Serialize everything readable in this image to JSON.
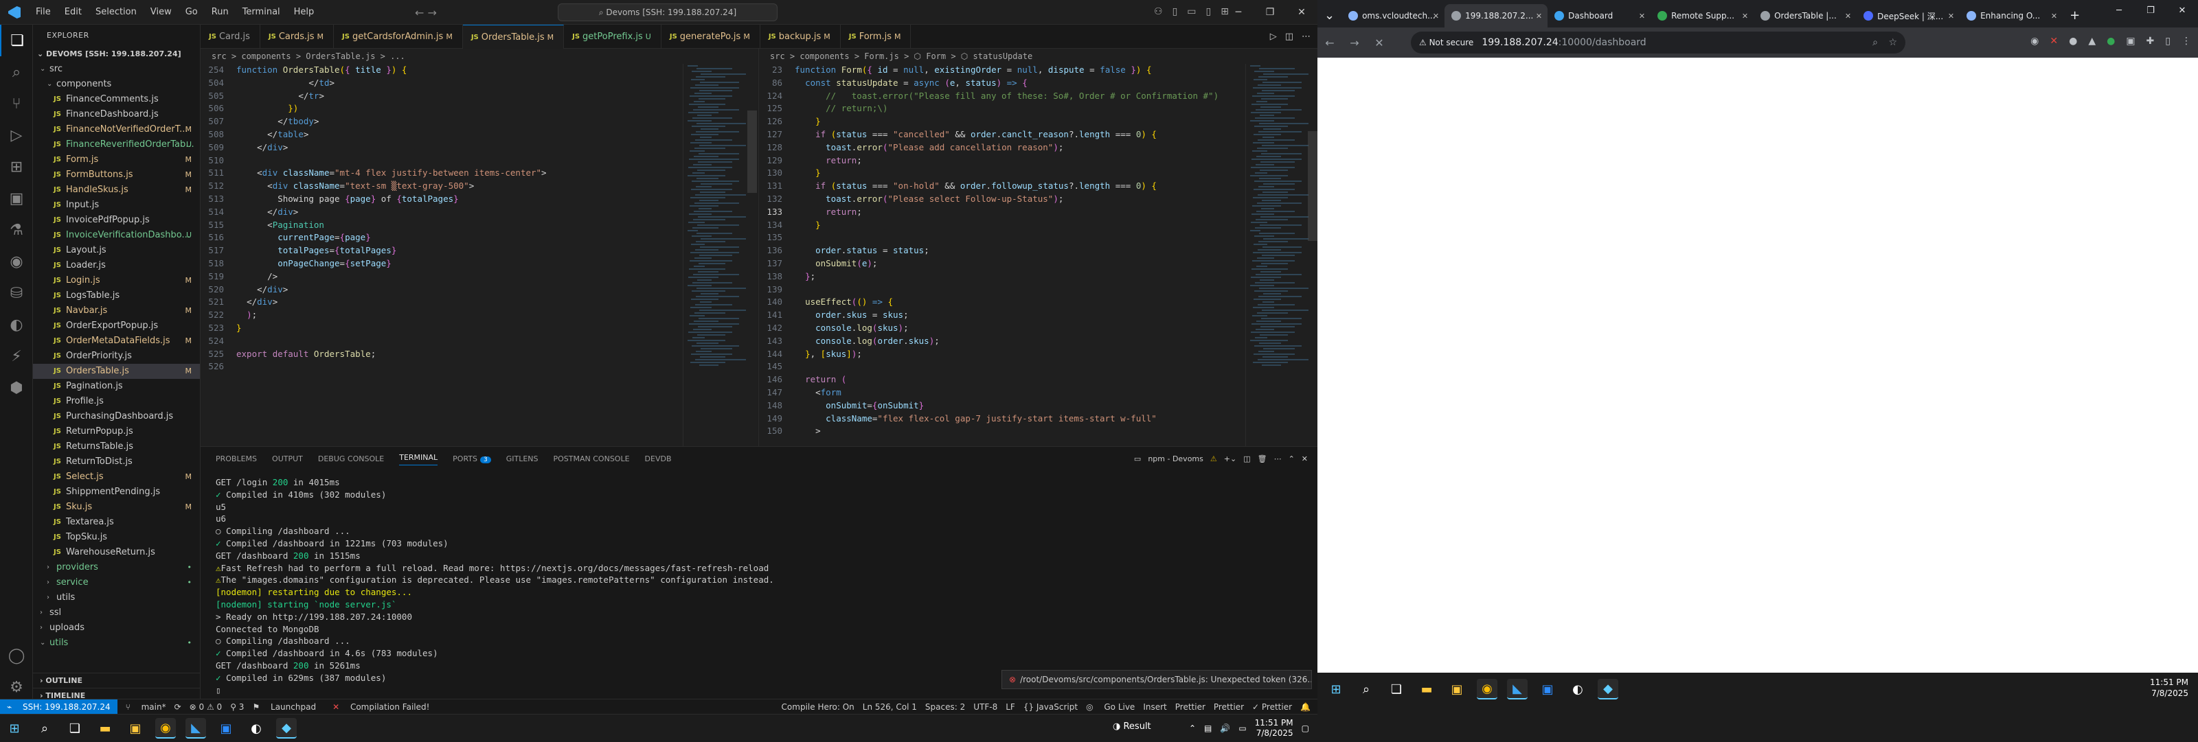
{
  "vscode": {
    "menu": [
      "File",
      "Edit",
      "Selection",
      "View",
      "Go",
      "Run",
      "Terminal",
      "Help"
    ],
    "command_center": "Devoms [SSH: 199.188.207.24]",
    "explorer_title": "EXPLORER",
    "workspace_root": "DEVOMS [SSH: 199.188.207.24]",
    "tree": [
      {
        "label": "src",
        "kind": "folder",
        "level": 1,
        "badge": ""
      },
      {
        "label": "components",
        "kind": "folder",
        "level": 2,
        "badge": ""
      },
      {
        "label": "FinanceComments.js",
        "kind": "file",
        "level": 3,
        "badge": ""
      },
      {
        "label": "FinanceDashboard.js",
        "kind": "file",
        "level": 3,
        "badge": ""
      },
      {
        "label": "FinanceNotVerifiedOrderT...",
        "kind": "file",
        "level": 3,
        "badge": "M"
      },
      {
        "label": "FinanceReverifiedOrderTab...",
        "kind": "file",
        "level": 3,
        "badge": "U"
      },
      {
        "label": "Form.js",
        "kind": "file",
        "level": 3,
        "badge": "M"
      },
      {
        "label": "FormButtons.js",
        "kind": "file",
        "level": 3,
        "badge": "M"
      },
      {
        "label": "HandleSkus.js",
        "kind": "file",
        "level": 3,
        "badge": "M"
      },
      {
        "label": "Input.js",
        "kind": "file",
        "level": 3,
        "badge": ""
      },
      {
        "label": "InvoicePdfPopup.js",
        "kind": "file",
        "level": 3,
        "badge": ""
      },
      {
        "label": "InvoiceVerificationDashbo...",
        "kind": "file",
        "level": 3,
        "badge": "U"
      },
      {
        "label": "Layout.js",
        "kind": "file",
        "level": 3,
        "badge": ""
      },
      {
        "label": "Loader.js",
        "kind": "file",
        "level": 3,
        "badge": ""
      },
      {
        "label": "Login.js",
        "kind": "file",
        "level": 3,
        "badge": "M"
      },
      {
        "label": "LogsTable.js",
        "kind": "file",
        "level": 3,
        "badge": ""
      },
      {
        "label": "Navbar.js",
        "kind": "file",
        "level": 3,
        "badge": "M"
      },
      {
        "label": "OrderExportPopup.js",
        "kind": "file",
        "level": 3,
        "badge": ""
      },
      {
        "label": "OrderMetaDataFields.js",
        "kind": "file",
        "level": 3,
        "badge": "M"
      },
      {
        "label": "OrderPriority.js",
        "kind": "file",
        "level": 3,
        "badge": ""
      },
      {
        "label": "OrdersTable.js",
        "kind": "file",
        "level": 3,
        "badge": "M",
        "selected": true
      },
      {
        "label": "Pagination.js",
        "kind": "file",
        "level": 3,
        "badge": ""
      },
      {
        "label": "Profile.js",
        "kind": "file",
        "level": 3,
        "badge": ""
      },
      {
        "label": "PurchasingDashboard.js",
        "kind": "file",
        "level": 3,
        "badge": ""
      },
      {
        "label": "ReturnPopup.js",
        "kind": "file",
        "level": 3,
        "badge": ""
      },
      {
        "label": "ReturnsTable.js",
        "kind": "file",
        "level": 3,
        "badge": ""
      },
      {
        "label": "ReturnToDist.js",
        "kind": "file",
        "level": 3,
        "badge": ""
      },
      {
        "label": "Select.js",
        "kind": "file",
        "level": 3,
        "badge": "M"
      },
      {
        "label": "ShippmentPending.js",
        "kind": "file",
        "level": 3,
        "badge": ""
      },
      {
        "label": "Sku.js",
        "kind": "file",
        "level": 3,
        "badge": "M"
      },
      {
        "label": "Textarea.js",
        "kind": "file",
        "level": 3,
        "badge": ""
      },
      {
        "label": "TopSku.js",
        "kind": "file",
        "level": 3,
        "badge": ""
      },
      {
        "label": "WarehouseReturn.js",
        "kind": "file",
        "level": 3,
        "badge": ""
      },
      {
        "label": "providers",
        "kind": "folder",
        "level": 2,
        "badge": "•"
      },
      {
        "label": "service",
        "kind": "folder",
        "level": 2,
        "badge": "•"
      },
      {
        "label": "utils",
        "kind": "folder",
        "level": 2,
        "badge": ""
      },
      {
        "label": "ssl",
        "kind": "folder",
        "level": 1,
        "badge": ""
      },
      {
        "label": "uploads",
        "kind": "folder",
        "level": 1,
        "badge": ""
      },
      {
        "label": "utils",
        "kind": "folder",
        "level": 1,
        "badge": "•"
      }
    ],
    "outline_label": "OUTLINE",
    "timeline_label": "TIMELINE",
    "tabs": [
      {
        "label": "Card.js",
        "mod": ""
      },
      {
        "label": "Cards.js",
        "mod": "M"
      },
      {
        "label": "getCardsforAdmin.js",
        "mod": "M"
      },
      {
        "label": "OrdersTable.js",
        "mod": "M",
        "active": true
      },
      {
        "label": "getPoPrefix.js",
        "mod": "U"
      },
      {
        "label": "generatePo.js",
        "mod": "M"
      },
      {
        "label": "backup.js",
        "mod": "M"
      },
      {
        "label": "Form.js",
        "mod": "M"
      }
    ],
    "left_breadcrumb": "src > components > OrdersTable.js > ...",
    "right_breadcrumb": "src > components > Form.js > ⬡ Form > ⬡ statusUpdate",
    "left_code": [
      {
        "n": "254",
        "html": "<span class='kw'>function</span> <span class='fn'>OrdersTable</span><span class='br'>(</span><span class='pk'>{</span> <span class='vr'>title</span> <span class='pk'>}</span><span class='br'>)</span> <span class='br'>{</span>"
      },
      {
        "n": "504",
        "html": "              <span class='tx'>&lt;/</span><span class='tg'>td</span><span class='tx'>&gt;</span>"
      },
      {
        "n": "505",
        "html": "            <span class='tx'>&lt;/</span><span class='tg'>tr</span><span class='tx'>&gt;</span>"
      },
      {
        "n": "506",
        "html": "          <span class='br'>})</span>"
      },
      {
        "n": "507",
        "html": "        <span class='tx'>&lt;/</span><span class='tg'>tbody</span><span class='tx'>&gt;</span>"
      },
      {
        "n": "508",
        "html": "      <span class='tx'>&lt;/</span><span class='tg'>table</span><span class='tx'>&gt;</span>"
      },
      {
        "n": "509",
        "html": "    <span class='tx'>&lt;/</span><span class='tg'>div</span><span class='tx'>&gt;</span>"
      },
      {
        "n": "510",
        "html": ""
      },
      {
        "n": "511",
        "html": "    <span class='tx'>&lt;</span><span class='tg'>div</span> <span class='at'>className</span><span class='tx'>=</span><span class='str'>\"mt-4 flex justify-between items-center\"</span><span class='tx'>&gt;</span>"
      },
      {
        "n": "512",
        "html": "      <span class='tx'>&lt;</span><span class='tg'>div</span> <span class='at'>className</span><span class='tx'>=</span><span class='str'>\"text-sm ▒text-gray-500\"</span><span class='tx'>&gt;</span>"
      },
      {
        "n": "513",
        "html": "        <span class='tx'>Showing page </span><span class='pk'>{</span><span class='vr'>page</span><span class='pk'>}</span><span class='tx'> of </span><span class='pk'>{</span><span class='vr'>totalPages</span><span class='pk'>}</span>"
      },
      {
        "n": "514",
        "html": "      <span class='tx'>&lt;/</span><span class='tg'>div</span><span class='tx'>&gt;</span>"
      },
      {
        "n": "515",
        "html": "      <span class='tx'>&lt;</span><span class='cp'>Pagination</span>"
      },
      {
        "n": "516",
        "html": "        <span class='at'>currentPage</span><span class='tx'>=</span><span class='pk'>{</span><span class='vr'>page</span><span class='pk'>}</span>"
      },
      {
        "n": "517",
        "html": "        <span class='at'>totalPages</span><span class='tx'>=</span><span class='pk'>{</span><span class='vr'>totalPages</span><span class='pk'>}</span>"
      },
      {
        "n": "518",
        "html": "        <span class='at'>onPageChange</span><span class='tx'>=</span><span class='pk'>{</span><span class='vr'>setPage</span><span class='pk'>}</span>"
      },
      {
        "n": "519",
        "html": "      <span class='tx'>/&gt;</span>"
      },
      {
        "n": "520",
        "html": "    <span class='tx'>&lt;/</span><span class='tg'>div</span><span class='tx'>&gt;</span>"
      },
      {
        "n": "521",
        "html": "  <span class='tx'>&lt;/</span><span class='tg'>div</span><span class='tx'>&gt;</span>"
      },
      {
        "n": "522",
        "html": "  <span class='pk'>)</span><span class='tx'>;</span>"
      },
      {
        "n": "523",
        "html": "<span class='br'>}</span>"
      },
      {
        "n": "524",
        "html": ""
      },
      {
        "n": "525",
        "html": "<span class='kc'>export</span> <span class='kc'>default</span> <span class='fn'>OrdersTable</span><span class='tx'>;</span>"
      },
      {
        "n": "526",
        "html": ""
      }
    ],
    "right_code": [
      {
        "n": "23",
        "html": "<span class='kw'>function</span> <span class='fn'>Form</span><span class='br'>(</span><span class='pk'>{</span> <span class='vr'>id</span> <span class='tx'>=</span> <span class='kw'>null</span><span class='tx'>,</span> <span class='vr'>existingOrder</span> <span class='tx'>=</span> <span class='kw'>null</span><span class='tx'>,</span> <span class='vr'>dispute</span> <span class='tx'>=</span> <span class='kw'>false</span> <span class='pk'>}</span><span class='br'>)</span> <span class='br'>{</span>"
      },
      {
        "n": "86",
        "html": "  <span class='kw'>const</span> <span class='fn'>statusUpdate</span> <span class='tx'>=</span> <span class='kw'>async</span> <span class='pk'>(</span><span class='vr'>e</span><span class='tx'>,</span> <span class='vr'>status</span><span class='pk'>)</span> <span class='kw'>=&gt;</span> <span class='pk'>{</span>"
      },
      {
        "n": "124",
        "html": "      <span class='cm'>//   toast.error(\"Please fill any of these: So#, Order # or Confirmation #\")</span>"
      },
      {
        "n": "125",
        "html": "      <span class='cm'>// return;\\)</span>"
      },
      {
        "n": "126",
        "html": "    <span class='br'>}</span>"
      },
      {
        "n": "127",
        "html": "    <span class='kc'>if</span> <span class='br'>(</span><span class='vr'>status</span> <span class='tx'>===</span> <span class='str'>\"cancelled\"</span> <span class='tx'>&amp;&amp;</span> <span class='vr'>order</span><span class='tx'>.</span><span class='vr'>canclt_reason</span><span class='tx'>?.</span><span class='vr'>length</span> <span class='tx'>===</span> <span class='nm'>0</span><span class='br'>)</span> <span class='br'>{</span>"
      },
      {
        "n": "128",
        "html": "      <span class='vr'>toast</span><span class='tx'>.</span><span class='fn'>error</span><span class='pk'>(</span><span class='str'>\"Please add cancellation reason\"</span><span class='pk'>)</span><span class='tx'>;</span>"
      },
      {
        "n": "129",
        "html": "      <span class='kc'>return</span><span class='tx'>;</span>"
      },
      {
        "n": "130",
        "html": "    <span class='br'>}</span>"
      },
      {
        "n": "131",
        "html": "    <span class='kc'>if</span> <span class='br'>(</span><span class='vr'>status</span> <span class='tx'>===</span> <span class='str'>\"on-hold\"</span> <span class='tx'>&amp;&amp;</span> <span class='vr'>order</span><span class='tx'>.</span><span class='vr'>followup_status</span><span class='tx'>?.</span><span class='vr'>length</span> <span class='tx'>===</span> <span class='nm'>0</span><span class='br'>)</span> <span class='br'>{</span>"
      },
      {
        "n": "132",
        "html": "      <span class='vr'>toast</span><span class='tx'>.</span><span class='fn'>error</span><span class='pk'>(</span><span class='str'>\"Please select Follow-up-Status\"</span><span class='pk'>)</span><span class='tx'>;</span>"
      },
      {
        "n": "133",
        "html": "      <span class='kc'>return</span><span class='tx'>;</span>",
        "cur": true
      },
      {
        "n": "134",
        "html": "    <span class='br'>}</span>"
      },
      {
        "n": "135",
        "html": ""
      },
      {
        "n": "136",
        "html": "    <span class='vr'>order</span><span class='tx'>.</span><span class='vr'>status</span> <span class='tx'>=</span> <span class='vr'>status</span><span class='tx'>;</span>"
      },
      {
        "n": "137",
        "html": "    <span class='fn'>onSubmit</span><span class='pk'>(</span><span class='vr'>e</span><span class='pk'>)</span><span class='tx'>;</span>"
      },
      {
        "n": "138",
        "html": "  <span class='pk'>}</span><span class='tx'>;</span>"
      },
      {
        "n": "139",
        "html": ""
      },
      {
        "n": "140",
        "html": "  <span class='fn'>useEffect</span><span class='pk'>(</span><span class='br'>()</span> <span class='kw'>=&gt;</span> <span class='br'>{</span>"
      },
      {
        "n": "141",
        "html": "    <span class='vr'>order</span><span class='tx'>.</span><span class='vr'>skus</span> <span class='tx'>=</span> <span class='vr'>skus</span><span class='tx'>;</span>"
      },
      {
        "n": "142",
        "html": "    <span class='vr'>console</span><span class='tx'>.</span><span class='fn'>log</span><span class='pk'>(</span><span class='vr'>skus</span><span class='pk'>)</span><span class='tx'>;</span>"
      },
      {
        "n": "143",
        "html": "    <span class='vr'>console</span><span class='tx'>.</span><span class='fn'>log</span><span class='pk'>(</span><span class='vr'>order</span><span class='tx'>.</span><span class='vr'>skus</span><span class='pk'>)</span><span class='tx'>;</span>"
      },
      {
        "n": "144",
        "html": "  <span class='br'>}</span><span class='tx'>,</span> <span class='br'>[</span><span class='vr'>skus</span><span class='br'>]</span><span class='pk'>)</span><span class='tx'>;</span>"
      },
      {
        "n": "145",
        "html": ""
      },
      {
        "n": "146",
        "html": "  <span class='kc'>return</span> <span class='pk'>(</span>"
      },
      {
        "n": "147",
        "html": "    <span class='tx'>&lt;</span><span class='tg'>form</span>"
      },
      {
        "n": "148",
        "html": "      <span class='at'>onSubmit</span><span class='tx'>=</span><span class='pk'>{</span><span class='vr'>onSubmit</span><span class='pk'>}</span>"
      },
      {
        "n": "149",
        "html": "      <span class='at'>className</span><span class='tx'>=</span><span class='str'>\"flex flex-col gap-7 justify-start items-start w-full\"</span>"
      },
      {
        "n": "150",
        "html": "    <span class='tx'>&gt;</span>"
      }
    ],
    "panel_tabs": [
      "PROBLEMS",
      "OUTPUT",
      "DEBUG CONSOLE",
      "TERMINAL",
      "PORTS",
      "GITLENS",
      "POSTMAN CONSOLE",
      "DEVDB"
    ],
    "ports_count": "3",
    "terminal_name": "npm - Devoms",
    "terminal_lines": [
      {
        "html": "<span>GET /login </span><span class='gr'>200</span><span> in 4015ms</span>"
      },
      {
        "html": "<span class='gr'>✓</span><span> Compiled in 410ms (302 modules)</span>"
      },
      {
        "html": "<span>u5</span>"
      },
      {
        "html": "<span>u6</span>"
      },
      {
        "html": "<span>○ Compiling /dashboard ...</span>"
      },
      {
        "html": "<span class='gr'>✓</span><span> Compiled /dashboard in 1221ms (703 modules)</span>"
      },
      {
        "html": "<span>GET /dashboard </span><span class='gr'>200</span><span> in 1515ms</span>"
      },
      {
        "html": "<span class='yl'>⚠</span><span>Fast Refresh had to perform a full reload. Read more: https://nextjs.org/docs/messages/fast-refresh-reload</span>"
      },
      {
        "html": "<span class='yl'>⚠</span><span>The \"images.domains\" configuration is deprecated. Please use \"images.remotePatterns\" configuration instead.</span>"
      },
      {
        "html": "<span class='yl'>[nodemon] restarting due to changes...</span>"
      },
      {
        "html": "<span class='gr'>[nodemon] starting `node server.js`</span>"
      },
      {
        "html": "<span>&gt; Ready on http://199.188.207.24:10000</span>"
      },
      {
        "html": "<span>Connected to MongoDB</span>"
      },
      {
        "html": "<span>○ Compiling /dashboard ...</span>"
      },
      {
        "html": "<span class='gr'>✓</span><span> Compiled /dashboard in 4.6s (783 modules)</span>"
      },
      {
        "html": "<span>GET /dashboard </span><span class='gr'>200</span><span> in 5261ms</span>"
      },
      {
        "html": "<span class='gr'>✓</span><span> Compiled in 629ms (387 modules)</span>"
      },
      {
        "html": "<span>▯</span>"
      }
    ],
    "notification": "/root/Devoms/src/components/OrdersTable.js: Unexpected token (326...",
    "status": {
      "remote": "SSH: 199.188.207.24",
      "branch": "main*",
      "sync": "⟳",
      "problems": "⊗ 0 ⚠ 0",
      "ports": "⚲ 3",
      "launchpad": "Launchpad",
      "compilation": "Compilation Failed!",
      "compile_hero": "Compile Hero: On",
      "position": "Ln 526, Col 1",
      "spaces": "Spaces: 2",
      "encoding": "UTF-8",
      "eol": "LF",
      "language": "{} JavaScript",
      "golive": "Go Live",
      "insert": "Insert",
      "prettier1": "Prettier",
      "prettier2": "Prettier",
      "prettier3": "✓ Prettier"
    }
  },
  "chrome": {
    "tabs": [
      {
        "label": "oms.vcloudtech...",
        "active": false
      },
      {
        "label": "199.188.207.2...",
        "active": true
      },
      {
        "label": "Dashboard",
        "active": false
      },
      {
        "label": "Remote Supp...",
        "active": false
      },
      {
        "label": "OrdersTable |...",
        "active": false
      },
      {
        "label": "DeepSeek | 深...",
        "active": false
      },
      {
        "label": "Enhancing O...",
        "active": false
      }
    ],
    "address_secure": "Not secure",
    "address_host": "199.188.207.24",
    "address_path": ":10000/dashboard"
  },
  "taskbar": {
    "time": "11:51 PM",
    "date": "7/8/2025",
    "weather_label": "Result"
  }
}
